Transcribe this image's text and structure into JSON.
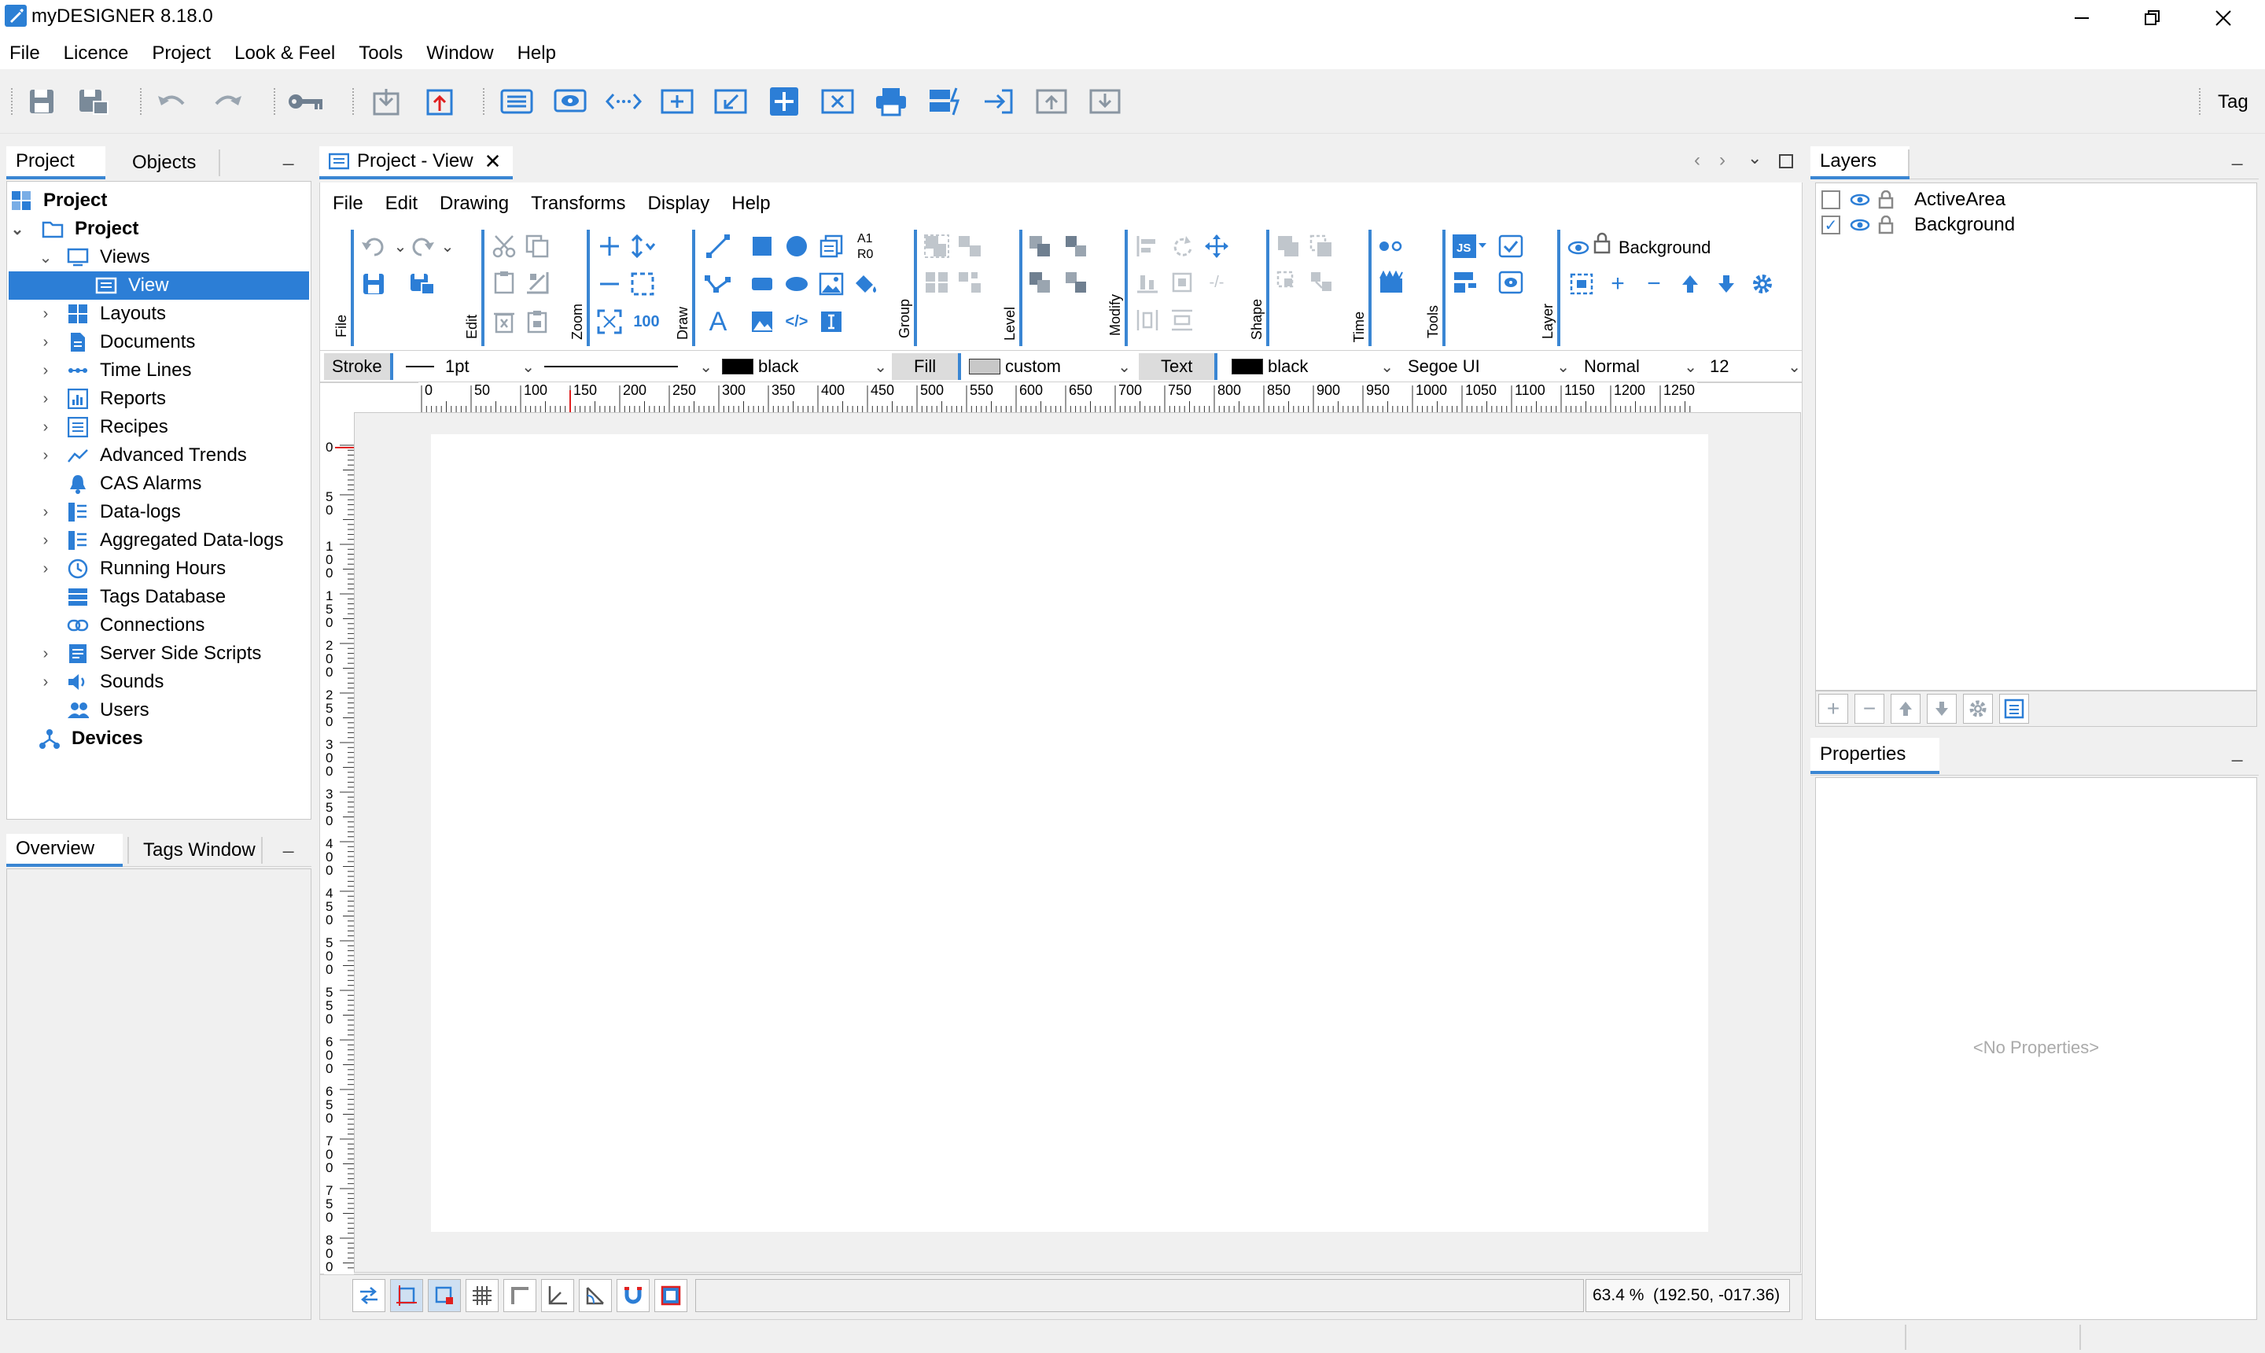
{
  "app": {
    "title": "myDESIGNER 8.18.0"
  },
  "menu": [
    "File",
    "Licence",
    "Project",
    "Look & Feel",
    "Tools",
    "Window",
    "Help"
  ],
  "toolbar": {
    "tag_label": "Tag"
  },
  "left_panel": {
    "tabs": [
      "Project",
      "Objects"
    ],
    "tree": [
      {
        "label": "Project",
        "bold": true
      },
      {
        "label": "Project",
        "bold": true
      },
      {
        "label": "Views"
      },
      {
        "label": "View"
      },
      {
        "label": "Layouts"
      },
      {
        "label": "Documents"
      },
      {
        "label": "Time Lines"
      },
      {
        "label": "Reports"
      },
      {
        "label": "Recipes"
      },
      {
        "label": "Advanced Trends"
      },
      {
        "label": "CAS Alarms"
      },
      {
        "label": "Data-logs"
      },
      {
        "label": "Aggregated Data-logs"
      },
      {
        "label": "Running Hours"
      },
      {
        "label": "Tags Database"
      },
      {
        "label": "Connections"
      },
      {
        "label": "Server Side Scripts"
      },
      {
        "label": "Sounds"
      },
      {
        "label": "Users"
      },
      {
        "label": "Devices",
        "bold": true
      }
    ],
    "bottom_tabs": [
      "Overview",
      "Tags Window"
    ]
  },
  "editor": {
    "tab_title": "Project - View",
    "menu": [
      "File",
      "Edit",
      "Drawing",
      "Transforms",
      "Display",
      "Help"
    ],
    "groups": [
      "File",
      "Edit",
      "Zoom",
      "Draw",
      "Group",
      "Level",
      "Modify",
      "Shape",
      "Time",
      "Tools",
      "Layer"
    ],
    "a1": "A1",
    "r0": "R0",
    "zoom_100": "100",
    "layer_current": "Background",
    "format": {
      "stroke_label": "Stroke",
      "stroke_width": "1pt",
      "stroke_color": "black",
      "fill_label": "Fill",
      "fill_color": "custom",
      "text_label": "Text",
      "text_color": "black",
      "font": "Segoe UI",
      "font_style": "Normal",
      "font_size": "12"
    },
    "ruler_h": [
      "0",
      "50",
      "100",
      "150",
      "200",
      "250",
      "300",
      "350",
      "400",
      "450",
      "500",
      "550",
      "600",
      "650",
      "700",
      "750",
      "800",
      "850",
      "900",
      "950",
      "1000",
      "1050",
      "1100",
      "1150",
      "1200",
      "1250"
    ],
    "ruler_v": [
      "0",
      "50",
      "100",
      "150",
      "200",
      "250",
      "300",
      "350",
      "400",
      "450",
      "500",
      "550",
      "600",
      "650",
      "700",
      "750",
      "800"
    ],
    "status": "63.4 %  (192.50, -017.36)"
  },
  "layers_panel": {
    "title": "Layers",
    "layers": [
      {
        "name": "ActiveArea",
        "checked": false
      },
      {
        "name": "Background",
        "checked": true
      }
    ]
  },
  "properties_panel": {
    "title": "Properties",
    "empty_text": "<No Properties>"
  },
  "colors": {
    "accent": "#3a86d3",
    "selection": "#2c7ed6"
  }
}
